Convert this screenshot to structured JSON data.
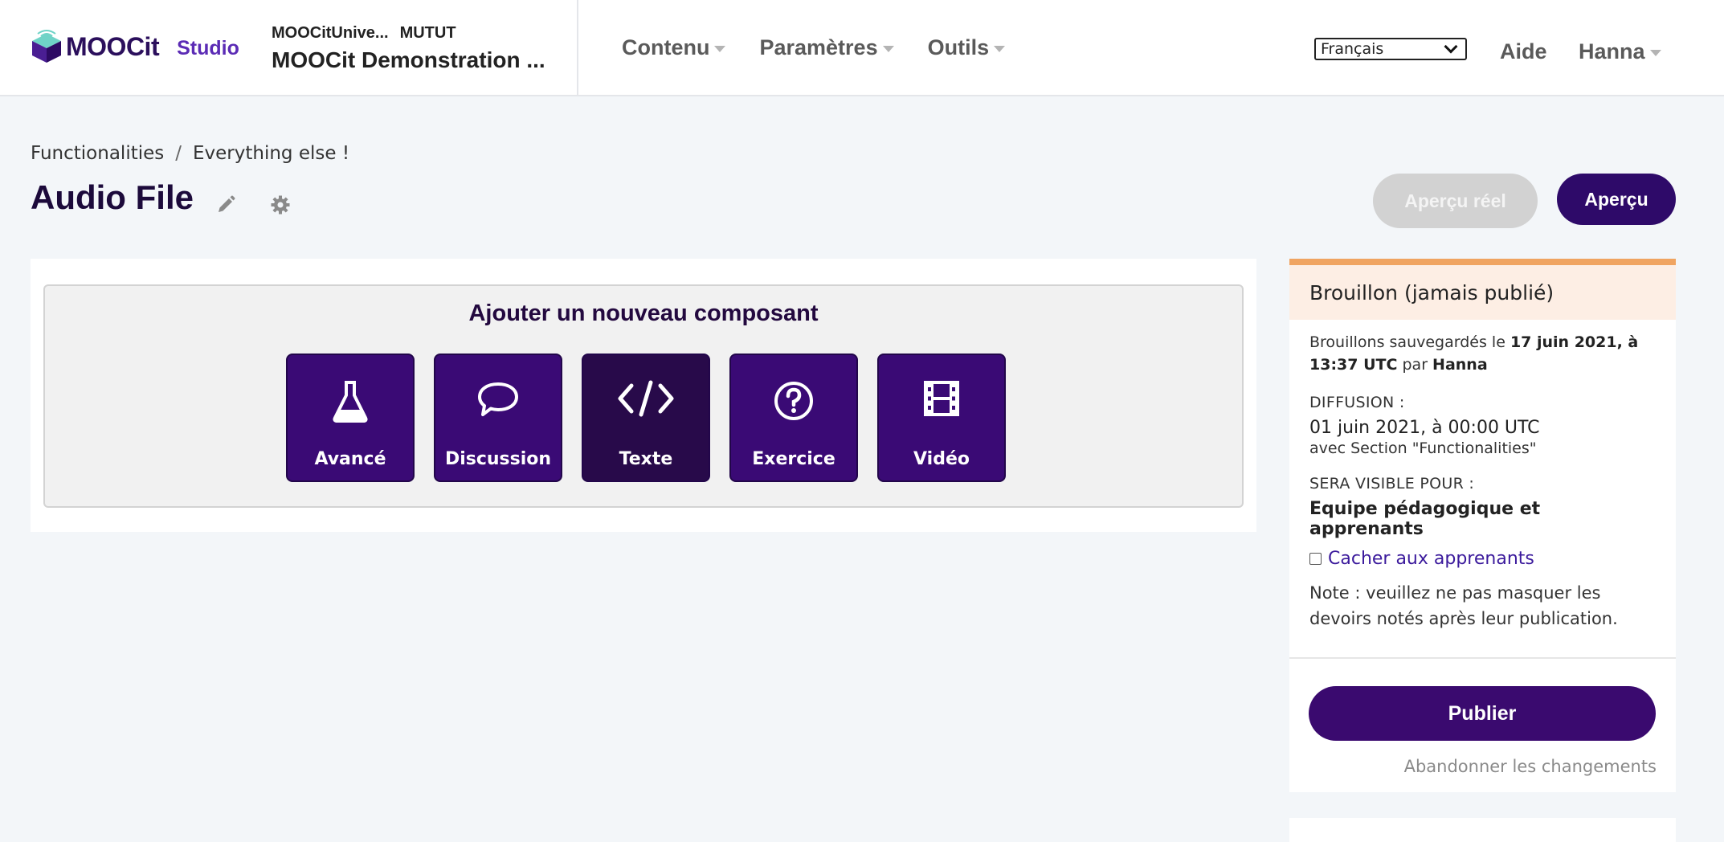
{
  "header": {
    "logo_text": "MOOCit",
    "studio_label": "Studio",
    "course_org": "MOOCitUnive...",
    "course_number": "MUTUT",
    "course_title": "MOOCit Demonstration ...",
    "nav": [
      {
        "label": "Contenu"
      },
      {
        "label": "Paramètres"
      },
      {
        "label": "Outils"
      }
    ],
    "language": "Français",
    "help": "Aide",
    "user": "Hanna"
  },
  "page": {
    "breadcrumb": [
      "Functionalities",
      "Everything else !"
    ],
    "breadcrumb_sep": "/",
    "title": "Audio File",
    "preview_live_label": "Aperçu réel",
    "preview_label": "Aperçu"
  },
  "add_component": {
    "title": "Ajouter un nouveau composant",
    "buttons": [
      {
        "label": "Avancé",
        "icon": "flask-icon"
      },
      {
        "label": "Discussion",
        "icon": "speech-bubble-icon"
      },
      {
        "label": "Texte",
        "icon": "code-icon"
      },
      {
        "label": "Exercice",
        "icon": "question-circle-icon"
      },
      {
        "label": "Vidéo",
        "icon": "film-icon"
      }
    ]
  },
  "status": {
    "heading": "Brouillon (jamais publié)",
    "saved_prefix": "Brouillons sauvegardés le",
    "saved_date": "17 juin 2021, à 13:37 UTC",
    "saved_by_prefix": "par",
    "saved_by": "Hanna",
    "release_label": "DIFFUSION :",
    "release_date": "01 juin 2021, à 00:00 UTC",
    "release_with": "avec Section \"Functionalities\"",
    "visible_label": "SERA VISIBLE POUR :",
    "visible_value": "Equipe pédagogique et apprenants",
    "hide_label": "Cacher aux apprenants",
    "hide_checked": false,
    "note": "Note : veuillez ne pas masquer les devoirs notés après leur publication.",
    "publish_label": "Publier",
    "discard_label": "Abandonner les changements"
  },
  "colors": {
    "brand": "#2e0a69",
    "component_button": "#3a0a75",
    "status_accent": "#f0a461",
    "link": "#3b1a9c"
  }
}
